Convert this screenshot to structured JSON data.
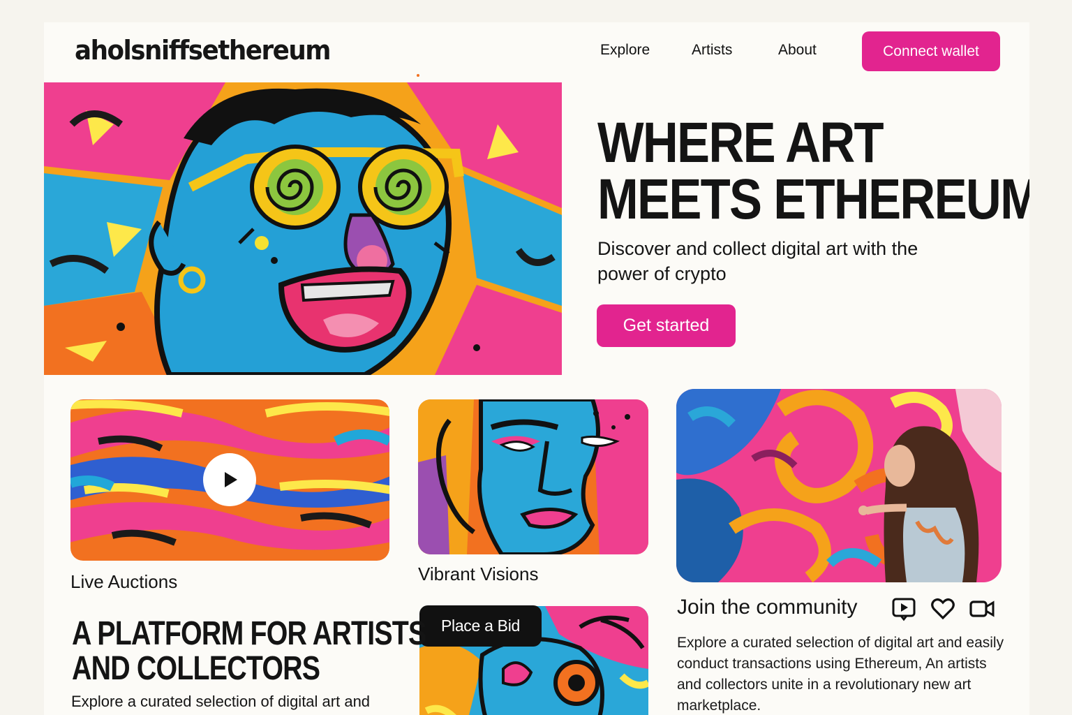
{
  "header": {
    "logo": "aholsniffsethereum",
    "nav": [
      "Explore",
      "Artists",
      "About"
    ],
    "connect_label": "Connect wallet"
  },
  "hero": {
    "title_line1": "WHERE ART",
    "title_line2": "MEETS ETHEREUM",
    "subtitle": "Discover and collect digital art with the power of crypto",
    "cta": "Get started"
  },
  "cards": {
    "live": "Live Auctions",
    "vibrant": "Vibrant Visions",
    "bid": "Place a Bid"
  },
  "platform": {
    "title_line1": "A PLATFORM FOR ARTISTS",
    "title_line2": "AND COLLECTORS",
    "text": "Explore a curated selection of digital art and"
  },
  "community": {
    "title": "Join the community",
    "icons": [
      "play-video-icon",
      "heart-icon",
      "video-camera-icon"
    ],
    "text": "Explore a curated selection of digital art and easily conduct transactions using Ethereum, An artists and collectors unite in a revolutionary new art marketplace."
  },
  "colors": {
    "accent": "#e2248f",
    "dark": "#111111",
    "background": "#fcfbf7"
  }
}
